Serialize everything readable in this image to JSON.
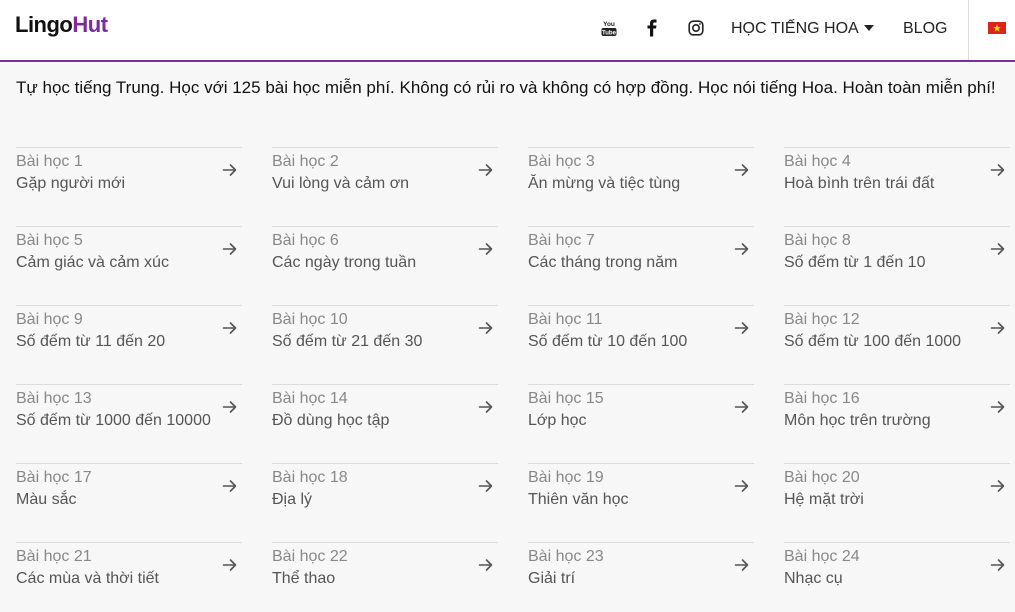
{
  "header": {
    "logo_part1": "Lingo",
    "logo_part2": "Hut",
    "social": [
      "youtube-icon",
      "facebook-icon",
      "instagram-icon"
    ],
    "menu_language": "HỌC TIẾNG HOA",
    "menu_blog": "BLOG",
    "flag": "vietnam-flag-icon",
    "accent_color": "#7b2d9e"
  },
  "intro": "Tự học tiếng Trung. Học với 125 bài học miễn phí. Không có rủi ro và không có hợp đồng. Học nói tiếng Hoa. Hoàn toàn miễn phí!",
  "lessons": [
    {
      "num": "Bài học 1",
      "title": "Gặp người mới"
    },
    {
      "num": "Bài học 2",
      "title": "Vui lòng và cảm ơn"
    },
    {
      "num": "Bài học 3",
      "title": "Ăn mừng và tiệc tùng"
    },
    {
      "num": "Bài học 4",
      "title": "Hoà bình trên trái đất"
    },
    {
      "num": "Bài học 5",
      "title": "Cảm giác và cảm xúc"
    },
    {
      "num": "Bài học 6",
      "title": "Các ngày trong tuần"
    },
    {
      "num": "Bài học 7",
      "title": "Các tháng trong năm"
    },
    {
      "num": "Bài học 8",
      "title": "Số đếm từ 1 đến 10"
    },
    {
      "num": "Bài học 9",
      "title": "Số đếm từ 11 đến 20"
    },
    {
      "num": "Bài học 10",
      "title": "Số đếm từ 21 đến 30"
    },
    {
      "num": "Bài học 11",
      "title": "Số đếm từ 10 đến 100"
    },
    {
      "num": "Bài học 12",
      "title": "Số đếm từ 100 đến 1000"
    },
    {
      "num": "Bài học 13",
      "title": "Số đếm từ 1000 đến 10000"
    },
    {
      "num": "Bài học 14",
      "title": "Đồ dùng học tập"
    },
    {
      "num": "Bài học 15",
      "title": "Lớp học"
    },
    {
      "num": "Bài học 16",
      "title": "Môn học trên trường"
    },
    {
      "num": "Bài học 17",
      "title": "Màu sắc"
    },
    {
      "num": "Bài học 18",
      "title": "Địa lý"
    },
    {
      "num": "Bài học 19",
      "title": "Thiên văn học"
    },
    {
      "num": "Bài học 20",
      "title": "Hệ mặt trời"
    },
    {
      "num": "Bài học 21",
      "title": "Các mùa và thời tiết"
    },
    {
      "num": "Bài học 22",
      "title": "Thể thao"
    },
    {
      "num": "Bài học 23",
      "title": "Giải trí"
    },
    {
      "num": "Bài học 24",
      "title": "Nhạc cụ"
    }
  ]
}
